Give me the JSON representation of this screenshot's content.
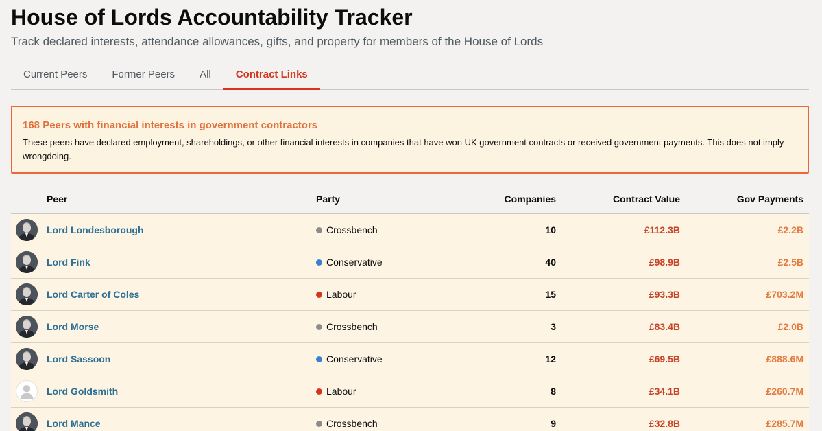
{
  "header": {
    "title": "House of Lords Accountability Tracker",
    "subtitle": "Track declared interests, attendance allowances, gifts, and property for members of the House of Lords"
  },
  "tabs": [
    {
      "label": "Current Peers",
      "active": false
    },
    {
      "label": "Former Peers",
      "active": false
    },
    {
      "label": "All",
      "active": false
    },
    {
      "label": "Contract Links",
      "active": true
    }
  ],
  "notice": {
    "title": "168 Peers with financial interests in government contractors",
    "text": "These peers have declared employment, shareholdings, or other financial interests in companies that have won UK government contracts or received government payments. This does not imply wrongdoing."
  },
  "table": {
    "headers": {
      "peer": "Peer",
      "party": "Party",
      "companies": "Companies",
      "contract_value": "Contract Value",
      "gov_payments": "Gov Payments"
    },
    "rows": [
      {
        "peer": "Lord Londesborough",
        "party": "Crossbench",
        "party_color": "#8c8c8c",
        "companies": "10",
        "contract_value": "£112.3B",
        "gov_payments": "£2.2B",
        "photo": true
      },
      {
        "peer": "Lord Fink",
        "party": "Conservative",
        "party_color": "#3a7fd0",
        "companies": "40",
        "contract_value": "£98.9B",
        "gov_payments": "£2.5B",
        "photo": true
      },
      {
        "peer": "Lord Carter of Coles",
        "party": "Labour",
        "party_color": "#d4351c",
        "companies": "15",
        "contract_value": "£93.3B",
        "gov_payments": "£703.2M",
        "photo": true
      },
      {
        "peer": "Lord Morse",
        "party": "Crossbench",
        "party_color": "#8c8c8c",
        "companies": "3",
        "contract_value": "£83.4B",
        "gov_payments": "£2.0B",
        "photo": true
      },
      {
        "peer": "Lord Sassoon",
        "party": "Conservative",
        "party_color": "#3a7fd0",
        "companies": "12",
        "contract_value": "£69.5B",
        "gov_payments": "£888.6M",
        "photo": true
      },
      {
        "peer": "Lord Goldsmith",
        "party": "Labour",
        "party_color": "#d4351c",
        "companies": "8",
        "contract_value": "£34.1B",
        "gov_payments": "£260.7M",
        "photo": false
      },
      {
        "peer": "Lord Mance",
        "party": "Crossbench",
        "party_color": "#8c8c8c",
        "companies": "9",
        "contract_value": "£32.8B",
        "gov_payments": "£285.7M",
        "photo": true
      }
    ]
  },
  "icons": {
    "avatar_photo": "person-portrait-icon",
    "avatar_placeholder": "person-silhouette-icon"
  }
}
